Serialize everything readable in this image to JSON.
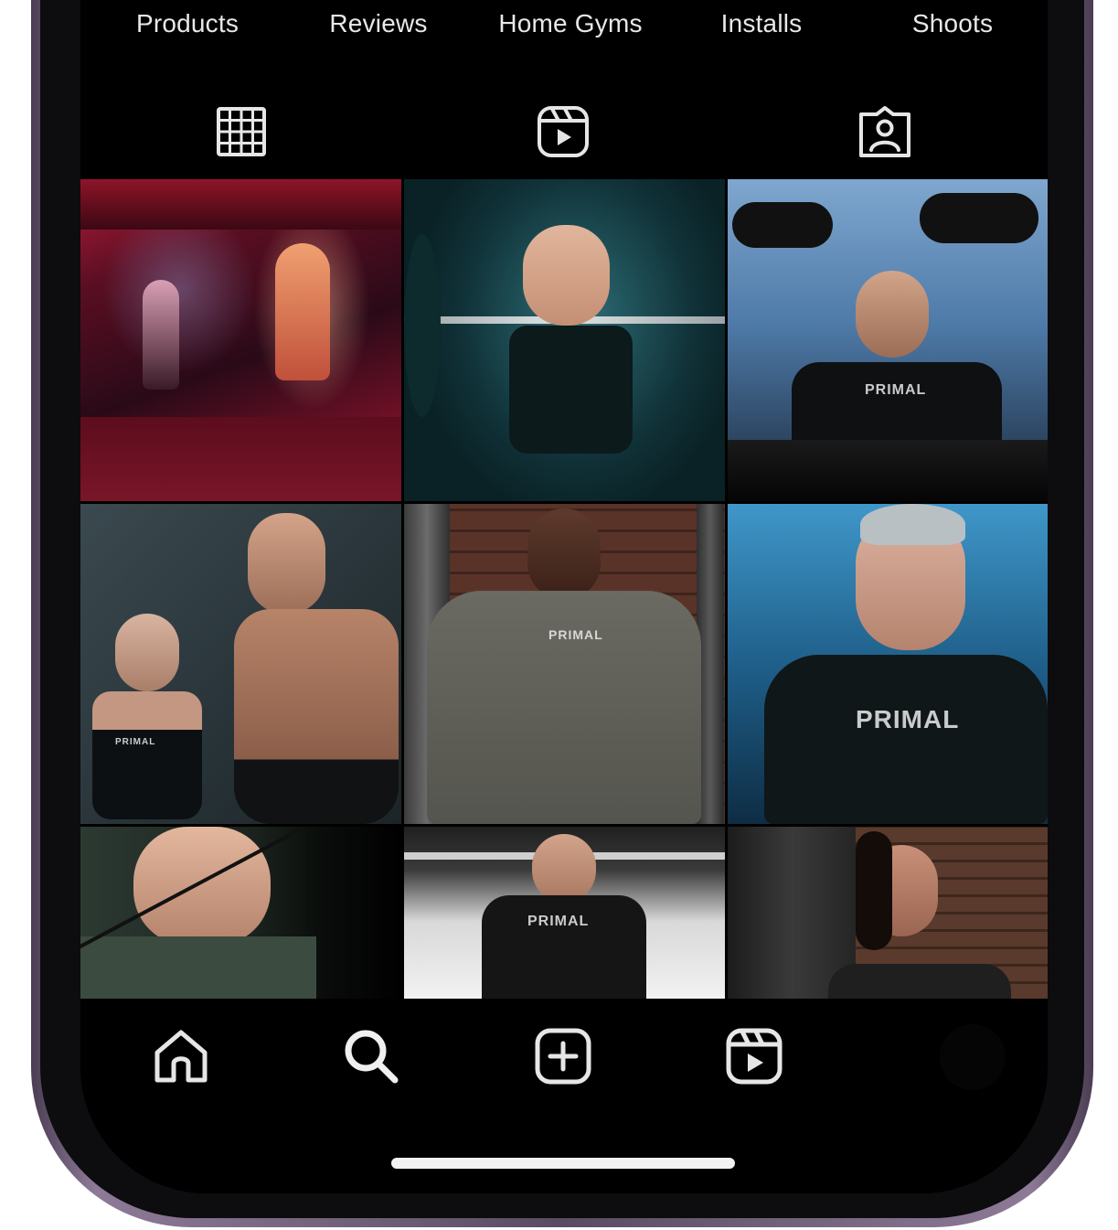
{
  "highlights": [
    {
      "label": "Products"
    },
    {
      "label": "Reviews"
    },
    {
      "label": "Home Gyms"
    },
    {
      "label": "Installs"
    },
    {
      "label": "Shoots"
    }
  ],
  "profile_tabs": [
    {
      "icon": "grid-icon",
      "active": true
    },
    {
      "icon": "reels-icon",
      "active": false
    },
    {
      "icon": "tagged-icon",
      "active": false
    }
  ],
  "grid_posts": [
    {
      "description_icon": "photo",
      "brand_text": ""
    },
    {
      "description_icon": "photo",
      "brand_text": ""
    },
    {
      "description_icon": "photo",
      "brand_text": "PRIMAL"
    },
    {
      "description_icon": "photo",
      "brand_text": "PRIMAL"
    },
    {
      "description_icon": "photo",
      "brand_text": "PRIMAL"
    },
    {
      "description_icon": "photo",
      "brand_text": "PRIMAL"
    },
    {
      "description_icon": "photo",
      "brand_text": ""
    },
    {
      "description_icon": "photo",
      "brand_text": "PRIMAL"
    },
    {
      "description_icon": "photo",
      "brand_text": ""
    }
  ],
  "bottom_nav": [
    {
      "icon": "home-icon"
    },
    {
      "icon": "search-icon"
    },
    {
      "icon": "create-post-icon"
    },
    {
      "icon": "reels-icon"
    }
  ],
  "colors": {
    "screen_bg": "#000000",
    "icon_color": "#e6e6e6",
    "frame": "#7d6a88"
  }
}
